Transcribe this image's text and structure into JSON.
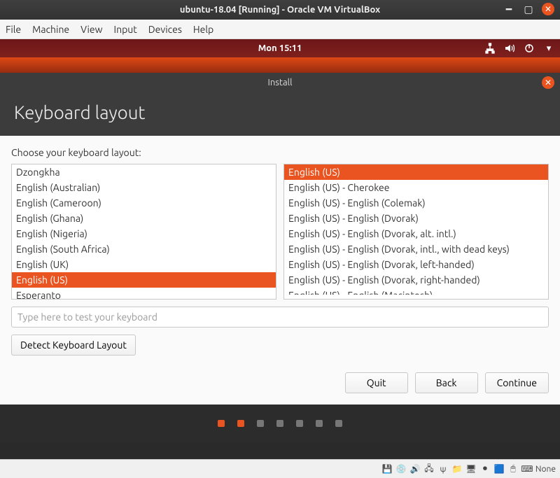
{
  "vbox": {
    "title": "ubuntu-18.04 [Running] - Oracle VM VirtualBox",
    "menu": [
      "File",
      "Machine",
      "View",
      "Input",
      "Devices",
      "Help"
    ],
    "status_text": "None"
  },
  "ubuntu_topbar": {
    "time": "Mon 15:11"
  },
  "installer": {
    "window_title": "Install",
    "heading": "Keyboard layout",
    "prompt": "Choose your keyboard layout:",
    "left_list": [
      "Dzongkha",
      "English (Australian)",
      "English (Cameroon)",
      "English (Ghana)",
      "English (Nigeria)",
      "English (South Africa)",
      "English (UK)",
      "English (US)",
      "Esperanto"
    ],
    "left_selected_index": 7,
    "right_list": [
      "English (US)",
      "English (US) - Cherokee",
      "English (US) - English (Colemak)",
      "English (US) - English (Dvorak)",
      "English (US) - English (Dvorak, alt. intl.)",
      "English (US) - English (Dvorak, intl., with dead keys)",
      "English (US) - English (Dvorak, left-handed)",
      "English (US) - English (Dvorak, right-handed)",
      "English (US) - English (Macintosh)"
    ],
    "right_selected_index": 0,
    "test_placeholder": "Type here to test your keyboard",
    "detect_label": "Detect Keyboard Layout",
    "nav": {
      "quit": "Quit",
      "back": "Back",
      "continue": "Continue"
    },
    "progress": {
      "total": 7,
      "current": 2
    }
  }
}
